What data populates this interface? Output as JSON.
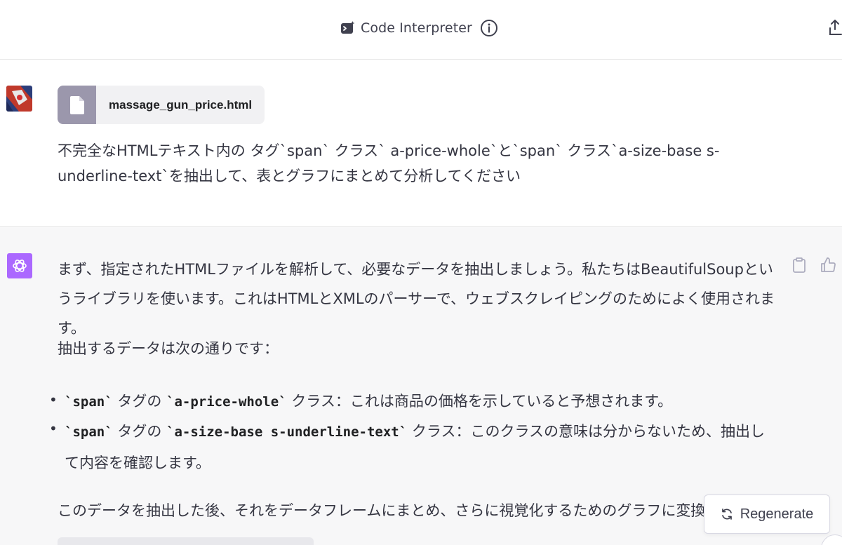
{
  "header": {
    "model_label": "Code Interpreter",
    "model_icon": "code-interpreter-icon",
    "info_icon": "info-icon",
    "share_icon": "share-icon"
  },
  "user_message": {
    "file_name": "massage_gun_price.html",
    "text": "不完全なHTMLテキスト内の タグ`span` クラス` a-price-whole`と`span` クラス`a-size-base s-underline-text`を抽出して、表とグラフにまとめて分析してください"
  },
  "assistant_message": {
    "paragraph1": "まず、指定されたHTMLファイルを解析して、必要なデータを抽出しましょう。私たちはBeautifulSoupというライブラリを使います。これはHTMLとXMLのパーサーで、ウェブスクレイピングのためによく使用されます。",
    "paragraph2": "抽出するデータは次の通りです：",
    "bullets": [
      {
        "code1": "`span`",
        "text1": "タグの",
        "code2": "`a-price-whole`",
        "text2": "クラス：これは商品の価格を示していると予想されます。"
      },
      {
        "code1": "`span`",
        "text1": "タグの",
        "code2": "`a-size-base s-underline-text`",
        "text2": "クラス：このクラスの意味は分からないため、抽出して内容を確認します。"
      }
    ],
    "paragraph3": "このデータを抽出した後、それをデータフレームにまとめ、さらに視覚化するためのグラフに変換します。"
  },
  "actions": {
    "copy_icon": "clipboard-icon",
    "like_icon": "thumbs-up-icon"
  },
  "regenerate_label": "Regenerate",
  "colors": {
    "assistant_bg": "#f7f7f8",
    "gpt_avatar": "#ab68ff",
    "file_icon_bg": "#9b97ac",
    "text": "#343541"
  }
}
